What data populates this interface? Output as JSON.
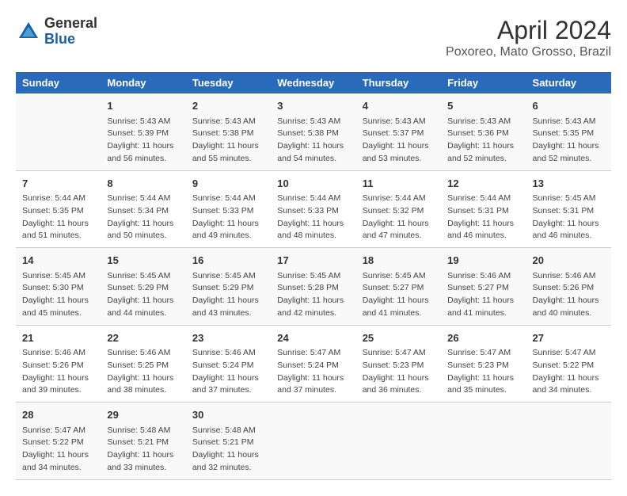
{
  "header": {
    "logo_general": "General",
    "logo_blue": "Blue",
    "month_year": "April 2024",
    "location": "Poxoreo, Mato Grosso, Brazil"
  },
  "columns": [
    "Sunday",
    "Monday",
    "Tuesday",
    "Wednesday",
    "Thursday",
    "Friday",
    "Saturday"
  ],
  "weeks": [
    [
      {
        "day": "",
        "info": ""
      },
      {
        "day": "1",
        "info": "Sunrise: 5:43 AM\nSunset: 5:39 PM\nDaylight: 11 hours\nand 56 minutes."
      },
      {
        "day": "2",
        "info": "Sunrise: 5:43 AM\nSunset: 5:38 PM\nDaylight: 11 hours\nand 55 minutes."
      },
      {
        "day": "3",
        "info": "Sunrise: 5:43 AM\nSunset: 5:38 PM\nDaylight: 11 hours\nand 54 minutes."
      },
      {
        "day": "4",
        "info": "Sunrise: 5:43 AM\nSunset: 5:37 PM\nDaylight: 11 hours\nand 53 minutes."
      },
      {
        "day": "5",
        "info": "Sunrise: 5:43 AM\nSunset: 5:36 PM\nDaylight: 11 hours\nand 52 minutes."
      },
      {
        "day": "6",
        "info": "Sunrise: 5:43 AM\nSunset: 5:35 PM\nDaylight: 11 hours\nand 52 minutes."
      }
    ],
    [
      {
        "day": "7",
        "info": "Sunrise: 5:44 AM\nSunset: 5:35 PM\nDaylight: 11 hours\nand 51 minutes."
      },
      {
        "day": "8",
        "info": "Sunrise: 5:44 AM\nSunset: 5:34 PM\nDaylight: 11 hours\nand 50 minutes."
      },
      {
        "day": "9",
        "info": "Sunrise: 5:44 AM\nSunset: 5:33 PM\nDaylight: 11 hours\nand 49 minutes."
      },
      {
        "day": "10",
        "info": "Sunrise: 5:44 AM\nSunset: 5:33 PM\nDaylight: 11 hours\nand 48 minutes."
      },
      {
        "day": "11",
        "info": "Sunrise: 5:44 AM\nSunset: 5:32 PM\nDaylight: 11 hours\nand 47 minutes."
      },
      {
        "day": "12",
        "info": "Sunrise: 5:44 AM\nSunset: 5:31 PM\nDaylight: 11 hours\nand 46 minutes."
      },
      {
        "day": "13",
        "info": "Sunrise: 5:45 AM\nSunset: 5:31 PM\nDaylight: 11 hours\nand 46 minutes."
      }
    ],
    [
      {
        "day": "14",
        "info": "Sunrise: 5:45 AM\nSunset: 5:30 PM\nDaylight: 11 hours\nand 45 minutes."
      },
      {
        "day": "15",
        "info": "Sunrise: 5:45 AM\nSunset: 5:29 PM\nDaylight: 11 hours\nand 44 minutes."
      },
      {
        "day": "16",
        "info": "Sunrise: 5:45 AM\nSunset: 5:29 PM\nDaylight: 11 hours\nand 43 minutes."
      },
      {
        "day": "17",
        "info": "Sunrise: 5:45 AM\nSunset: 5:28 PM\nDaylight: 11 hours\nand 42 minutes."
      },
      {
        "day": "18",
        "info": "Sunrise: 5:45 AM\nSunset: 5:27 PM\nDaylight: 11 hours\nand 41 minutes."
      },
      {
        "day": "19",
        "info": "Sunrise: 5:46 AM\nSunset: 5:27 PM\nDaylight: 11 hours\nand 41 minutes."
      },
      {
        "day": "20",
        "info": "Sunrise: 5:46 AM\nSunset: 5:26 PM\nDaylight: 11 hours\nand 40 minutes."
      }
    ],
    [
      {
        "day": "21",
        "info": "Sunrise: 5:46 AM\nSunset: 5:26 PM\nDaylight: 11 hours\nand 39 minutes."
      },
      {
        "day": "22",
        "info": "Sunrise: 5:46 AM\nSunset: 5:25 PM\nDaylight: 11 hours\nand 38 minutes."
      },
      {
        "day": "23",
        "info": "Sunrise: 5:46 AM\nSunset: 5:24 PM\nDaylight: 11 hours\nand 37 minutes."
      },
      {
        "day": "24",
        "info": "Sunrise: 5:47 AM\nSunset: 5:24 PM\nDaylight: 11 hours\nand 37 minutes."
      },
      {
        "day": "25",
        "info": "Sunrise: 5:47 AM\nSunset: 5:23 PM\nDaylight: 11 hours\nand 36 minutes."
      },
      {
        "day": "26",
        "info": "Sunrise: 5:47 AM\nSunset: 5:23 PM\nDaylight: 11 hours\nand 35 minutes."
      },
      {
        "day": "27",
        "info": "Sunrise: 5:47 AM\nSunset: 5:22 PM\nDaylight: 11 hours\nand 34 minutes."
      }
    ],
    [
      {
        "day": "28",
        "info": "Sunrise: 5:47 AM\nSunset: 5:22 PM\nDaylight: 11 hours\nand 34 minutes."
      },
      {
        "day": "29",
        "info": "Sunrise: 5:48 AM\nSunset: 5:21 PM\nDaylight: 11 hours\nand 33 minutes."
      },
      {
        "day": "30",
        "info": "Sunrise: 5:48 AM\nSunset: 5:21 PM\nDaylight: 11 hours\nand 32 minutes."
      },
      {
        "day": "",
        "info": ""
      },
      {
        "day": "",
        "info": ""
      },
      {
        "day": "",
        "info": ""
      },
      {
        "day": "",
        "info": ""
      }
    ]
  ]
}
